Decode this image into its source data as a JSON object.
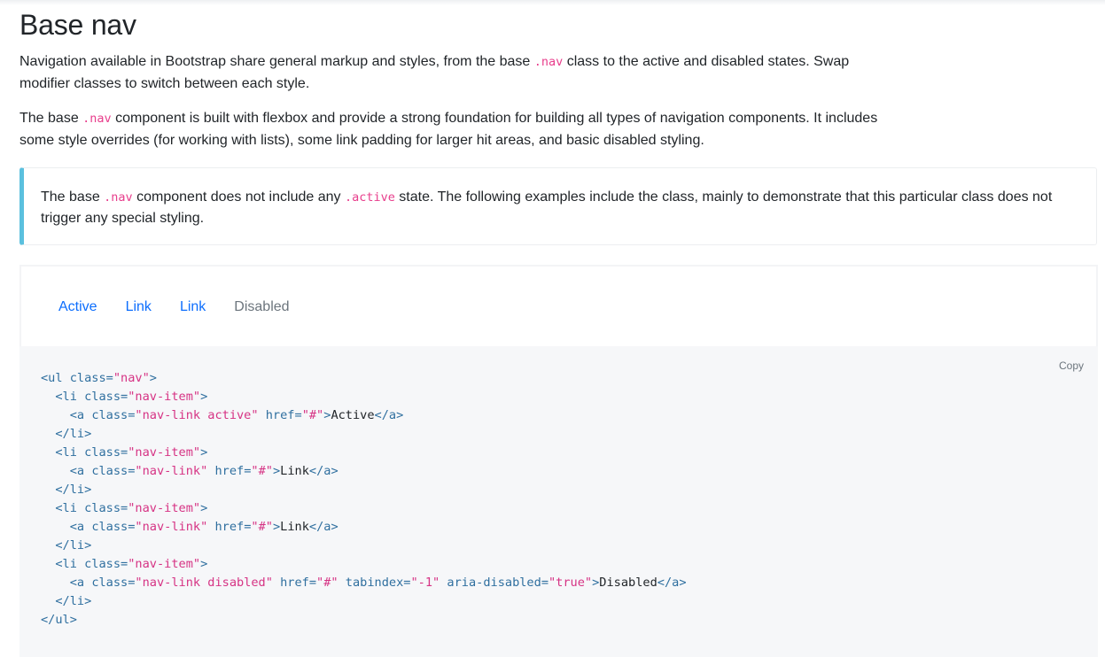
{
  "page": {
    "title": "Base nav",
    "intro": {
      "before": "Navigation available in Bootstrap share general markup and styles, from the base ",
      "code": ".nav",
      "after": " class to the active and disabled states. Swap modifier classes to switch between each style."
    },
    "description": {
      "before": "The base ",
      "code": ".nav",
      "after": " component is built with flexbox and provide a strong foundation for building all types of navigation components. It includes some style overrides (for working with lists), some link padding for larger hit areas, and basic disabled styling."
    },
    "callout": {
      "before": "The base ",
      "code1": ".nav",
      "middle": " component does not include any ",
      "code2": ".active",
      "after": " state. The following examples include the class, mainly to demonstrate that this particular class does not trigger any special styling."
    }
  },
  "example": {
    "nav_items": [
      {
        "label": "Active"
      },
      {
        "label": "Link"
      },
      {
        "label": "Link"
      },
      {
        "label": "Disabled"
      }
    ]
  },
  "code": {
    "copy_label": "Copy",
    "lines": [
      {
        "indent": "",
        "tokens": [
          [
            "tag",
            "<ul "
          ],
          [
            "attr",
            "class"
          ],
          [
            "punc",
            "="
          ],
          [
            "val",
            "\"nav\""
          ],
          [
            "tag",
            ">"
          ]
        ]
      },
      {
        "indent": "  ",
        "tokens": [
          [
            "tag",
            "<li "
          ],
          [
            "attr",
            "class"
          ],
          [
            "punc",
            "="
          ],
          [
            "val",
            "\"nav-item\""
          ],
          [
            "tag",
            ">"
          ]
        ]
      },
      {
        "indent": "    ",
        "tokens": [
          [
            "tag",
            "<a "
          ],
          [
            "attr",
            "class"
          ],
          [
            "punc",
            "="
          ],
          [
            "val",
            "\"nav-link active\""
          ],
          [
            "txt",
            " "
          ],
          [
            "attr",
            "href"
          ],
          [
            "punc",
            "="
          ],
          [
            "val",
            "\"#\""
          ],
          [
            "tag",
            ">"
          ],
          [
            "txt",
            "Active"
          ],
          [
            "tag",
            "</a>"
          ]
        ]
      },
      {
        "indent": "  ",
        "tokens": [
          [
            "tag",
            "</li>"
          ]
        ]
      },
      {
        "indent": "  ",
        "tokens": [
          [
            "tag",
            "<li "
          ],
          [
            "attr",
            "class"
          ],
          [
            "punc",
            "="
          ],
          [
            "val",
            "\"nav-item\""
          ],
          [
            "tag",
            ">"
          ]
        ]
      },
      {
        "indent": "    ",
        "tokens": [
          [
            "tag",
            "<a "
          ],
          [
            "attr",
            "class"
          ],
          [
            "punc",
            "="
          ],
          [
            "val",
            "\"nav-link\""
          ],
          [
            "txt",
            " "
          ],
          [
            "attr",
            "href"
          ],
          [
            "punc",
            "="
          ],
          [
            "val",
            "\"#\""
          ],
          [
            "tag",
            ">"
          ],
          [
            "txt",
            "Link"
          ],
          [
            "tag",
            "</a>"
          ]
        ]
      },
      {
        "indent": "  ",
        "tokens": [
          [
            "tag",
            "</li>"
          ]
        ]
      },
      {
        "indent": "  ",
        "tokens": [
          [
            "tag",
            "<li "
          ],
          [
            "attr",
            "class"
          ],
          [
            "punc",
            "="
          ],
          [
            "val",
            "\"nav-item\""
          ],
          [
            "tag",
            ">"
          ]
        ]
      },
      {
        "indent": "    ",
        "tokens": [
          [
            "tag",
            "<a "
          ],
          [
            "attr",
            "class"
          ],
          [
            "punc",
            "="
          ],
          [
            "val",
            "\"nav-link\""
          ],
          [
            "txt",
            " "
          ],
          [
            "attr",
            "href"
          ],
          [
            "punc",
            "="
          ],
          [
            "val",
            "\"#\""
          ],
          [
            "tag",
            ">"
          ],
          [
            "txt",
            "Link"
          ],
          [
            "tag",
            "</a>"
          ]
        ]
      },
      {
        "indent": "  ",
        "tokens": [
          [
            "tag",
            "</li>"
          ]
        ]
      },
      {
        "indent": "  ",
        "tokens": [
          [
            "tag",
            "<li "
          ],
          [
            "attr",
            "class"
          ],
          [
            "punc",
            "="
          ],
          [
            "val",
            "\"nav-item\""
          ],
          [
            "tag",
            ">"
          ]
        ]
      },
      {
        "indent": "    ",
        "tokens": [
          [
            "tag",
            "<a "
          ],
          [
            "attr",
            "class"
          ],
          [
            "punc",
            "="
          ],
          [
            "val",
            "\"nav-link disabled\""
          ],
          [
            "txt",
            " "
          ],
          [
            "attr",
            "href"
          ],
          [
            "punc",
            "="
          ],
          [
            "val",
            "\"#\""
          ],
          [
            "txt",
            " "
          ],
          [
            "attr",
            "tabindex"
          ],
          [
            "punc",
            "="
          ],
          [
            "val",
            "\"-1\""
          ],
          [
            "txt",
            " "
          ],
          [
            "attr",
            "aria-disabled"
          ],
          [
            "punc",
            "="
          ],
          [
            "val",
            "\"true\""
          ],
          [
            "tag",
            ">"
          ],
          [
            "txt",
            "Disabled"
          ],
          [
            "tag",
            "</a>"
          ]
        ]
      },
      {
        "indent": "  ",
        "tokens": [
          [
            "tag",
            "</li>"
          ]
        ]
      },
      {
        "indent": "",
        "tokens": [
          [
            "tag",
            "</ul>"
          ]
        ]
      }
    ]
  },
  "colors": {
    "link": "#0d6efd",
    "disabled": "#6c757d",
    "code_inline": "#e83e8c",
    "callout_border": "#5bc0de",
    "code_bg": "#f6f7f9"
  }
}
